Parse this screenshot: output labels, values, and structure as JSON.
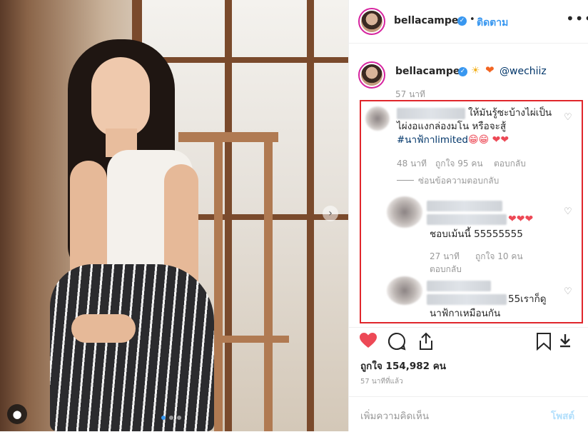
{
  "post": {
    "username": "bellacampen",
    "follow_label": "ติดตาม",
    "separator": "•",
    "more_icon": "more-horizontal-icon",
    "verified_icon": "verified-badge-icon"
  },
  "caption": {
    "username": "bellacampen",
    "emojis": [
      "sun-face-emoji",
      "orange-heart-emoji"
    ],
    "mention": "@wechiiz",
    "time": "57 นาที"
  },
  "comments": [
    {
      "text_line1": "ให้มันรู้ซะบ้างไผ่เป็น",
      "text_line2": "ไผ่งอแงกล่องมโน หรือจะสู้",
      "hashtag": "#นาฟ้กาlimited",
      "emoji_tail": "😁😁 ❤❤",
      "time": "48 นาที",
      "likes": "ถูกใจ 95 คน",
      "reply_label": "ตอบกลับ",
      "hide_replies_label": "ซ่อนข้อความตอบกลับ",
      "replies": [
        {
          "hearts": "❤❤❤",
          "text": "ชอบเม้นนี้ 55555555",
          "time": "27 นาที",
          "likes": "ถูกใจ 10 คน",
          "reply_label": "ตอบกลับ"
        },
        {
          "text_line1": "55เราก็ดู",
          "text_line2": "นาฟ้กาเหมือนกัน"
        }
      ]
    }
  ],
  "actions": {
    "like_icon": "heart-filled-icon",
    "comment_icon": "comment-icon",
    "share_icon": "share-icon",
    "save_icon": "bookmark-icon",
    "download_icon": "download-icon"
  },
  "likes_text": "ถูกใจ 154,982 คน",
  "time_ago": "57 นาทีที่แล้ว",
  "add_comment": {
    "placeholder": "เพิ่มความคิดเห็น",
    "post_label": "โพสต์"
  },
  "carousel": {
    "slides": 3,
    "active": 1
  },
  "colors": {
    "accent": "#3897f0",
    "like": "#ed4956",
    "highlight_box": "#e0262b",
    "hashtag": "#003569"
  }
}
